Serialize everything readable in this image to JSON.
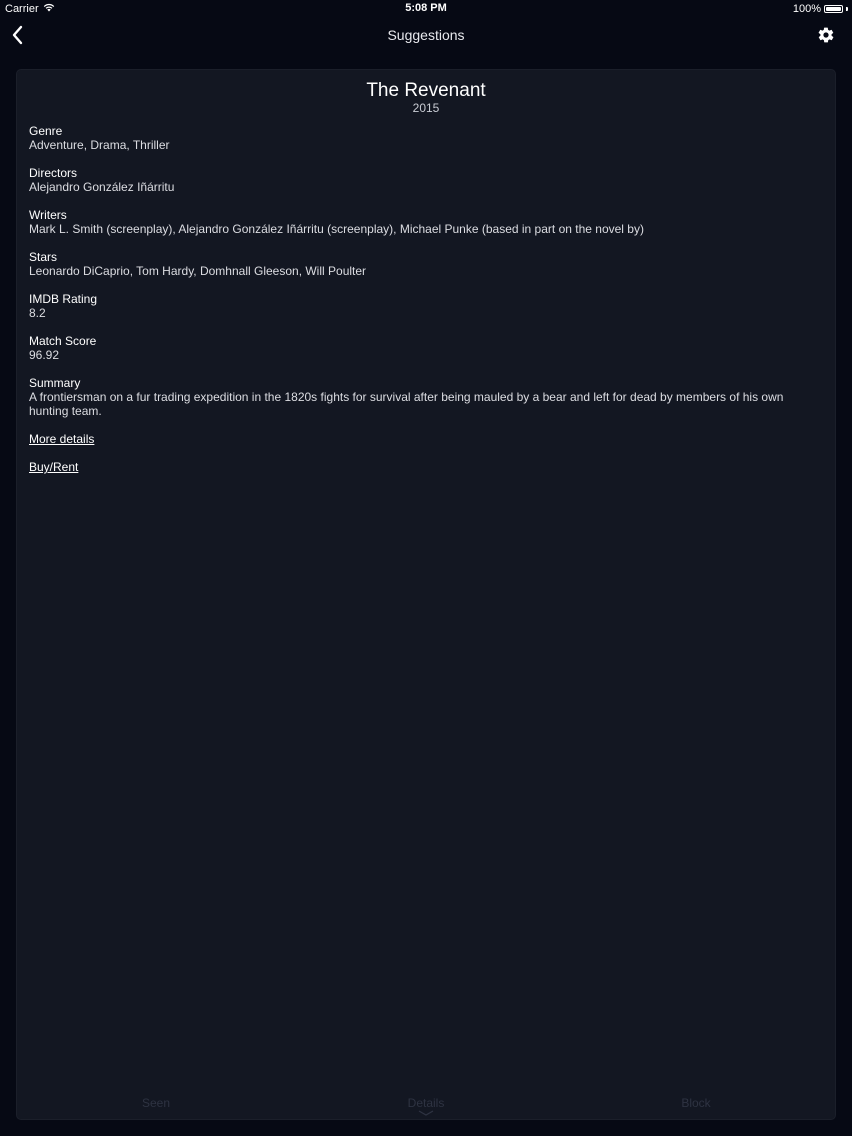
{
  "status_bar": {
    "carrier": "Carrier",
    "time": "5:08 PM",
    "battery": "100%"
  },
  "nav": {
    "title": "Suggestions",
    "back_icon": "chevron-left-icon",
    "settings_icon": "gear-icon"
  },
  "movie": {
    "title": "The Revenant",
    "year": "2015",
    "fields": [
      {
        "label": "Genre",
        "value": "Adventure, Drama, Thriller"
      },
      {
        "label": "Directors",
        "value": "Alejandro González Iñárritu"
      },
      {
        "label": "Writers",
        "value": "Mark L. Smith (screenplay), Alejandro González Iñárritu (screenplay), Michael Punke (based in part on the novel by)"
      },
      {
        "label": "Stars",
        "value": "Leonardo DiCaprio, Tom Hardy, Domhnall Gleeson, Will Poulter"
      },
      {
        "label": "IMDB Rating",
        "value": "8.2"
      },
      {
        "label": "Match Score",
        "value": "96.92"
      },
      {
        "label": "Summary",
        "value": "A frontiersman on a fur trading expedition in the 1820s fights for survival after being mauled by a bear and left for dead by members of his own hunting team."
      }
    ],
    "more_details": "More details",
    "buy_rent": "Buy/Rent"
  },
  "tabs": [
    {
      "label": "Seen"
    },
    {
      "label": "Details"
    },
    {
      "label": "Block"
    }
  ],
  "colors": {
    "background": "#060914",
    "card": "#131722",
    "tab_text": "#2e3342"
  }
}
